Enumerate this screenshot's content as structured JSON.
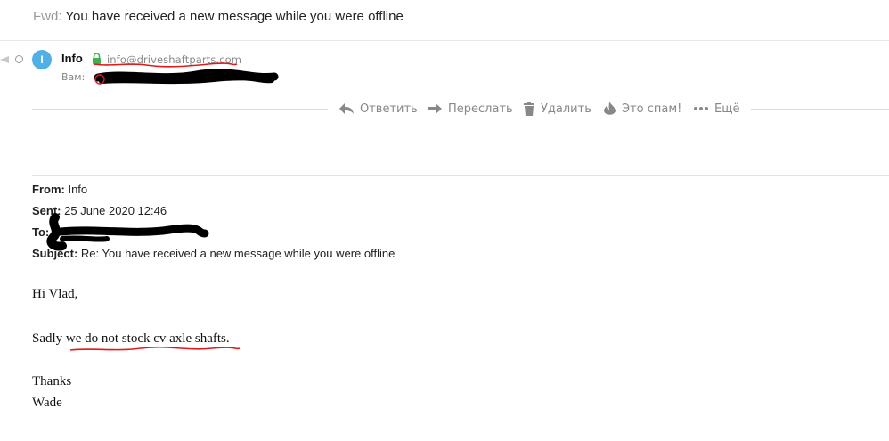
{
  "message": {
    "subject_prefix": "Fwd:",
    "subject": "You have received a new message while you were offline"
  },
  "sender": {
    "avatar_letter": "I",
    "avatar_color": "#4fb0e8",
    "name": "Info",
    "email": "info@driveshaftparts.com",
    "recipient_label": "Вам:"
  },
  "toolbar": {
    "reply": "Ответить",
    "forward": "Переслать",
    "delete": "Удалить",
    "spam": "Это спам!",
    "more": "Ещё"
  },
  "quoted_header": {
    "from_label": "From:",
    "from_value": "Info",
    "sent_label": "Sent:",
    "sent_value": "25 June 2020 12:46",
    "to_label": "To:",
    "subject_label": "Subject:",
    "subject_value": "Re: You have received a new message while you were offline"
  },
  "body": {
    "greeting": "Hi Vlad,",
    "line1": "Sadly we do not stock cv axle shafts.",
    "closing": "Thanks",
    "signature": "Wade"
  },
  "colors": {
    "accent_avatar": "#4fb0e8",
    "lock_green": "#3cb44b",
    "annotation_red": "#e0191b",
    "toolbar_gray": "#888888"
  }
}
